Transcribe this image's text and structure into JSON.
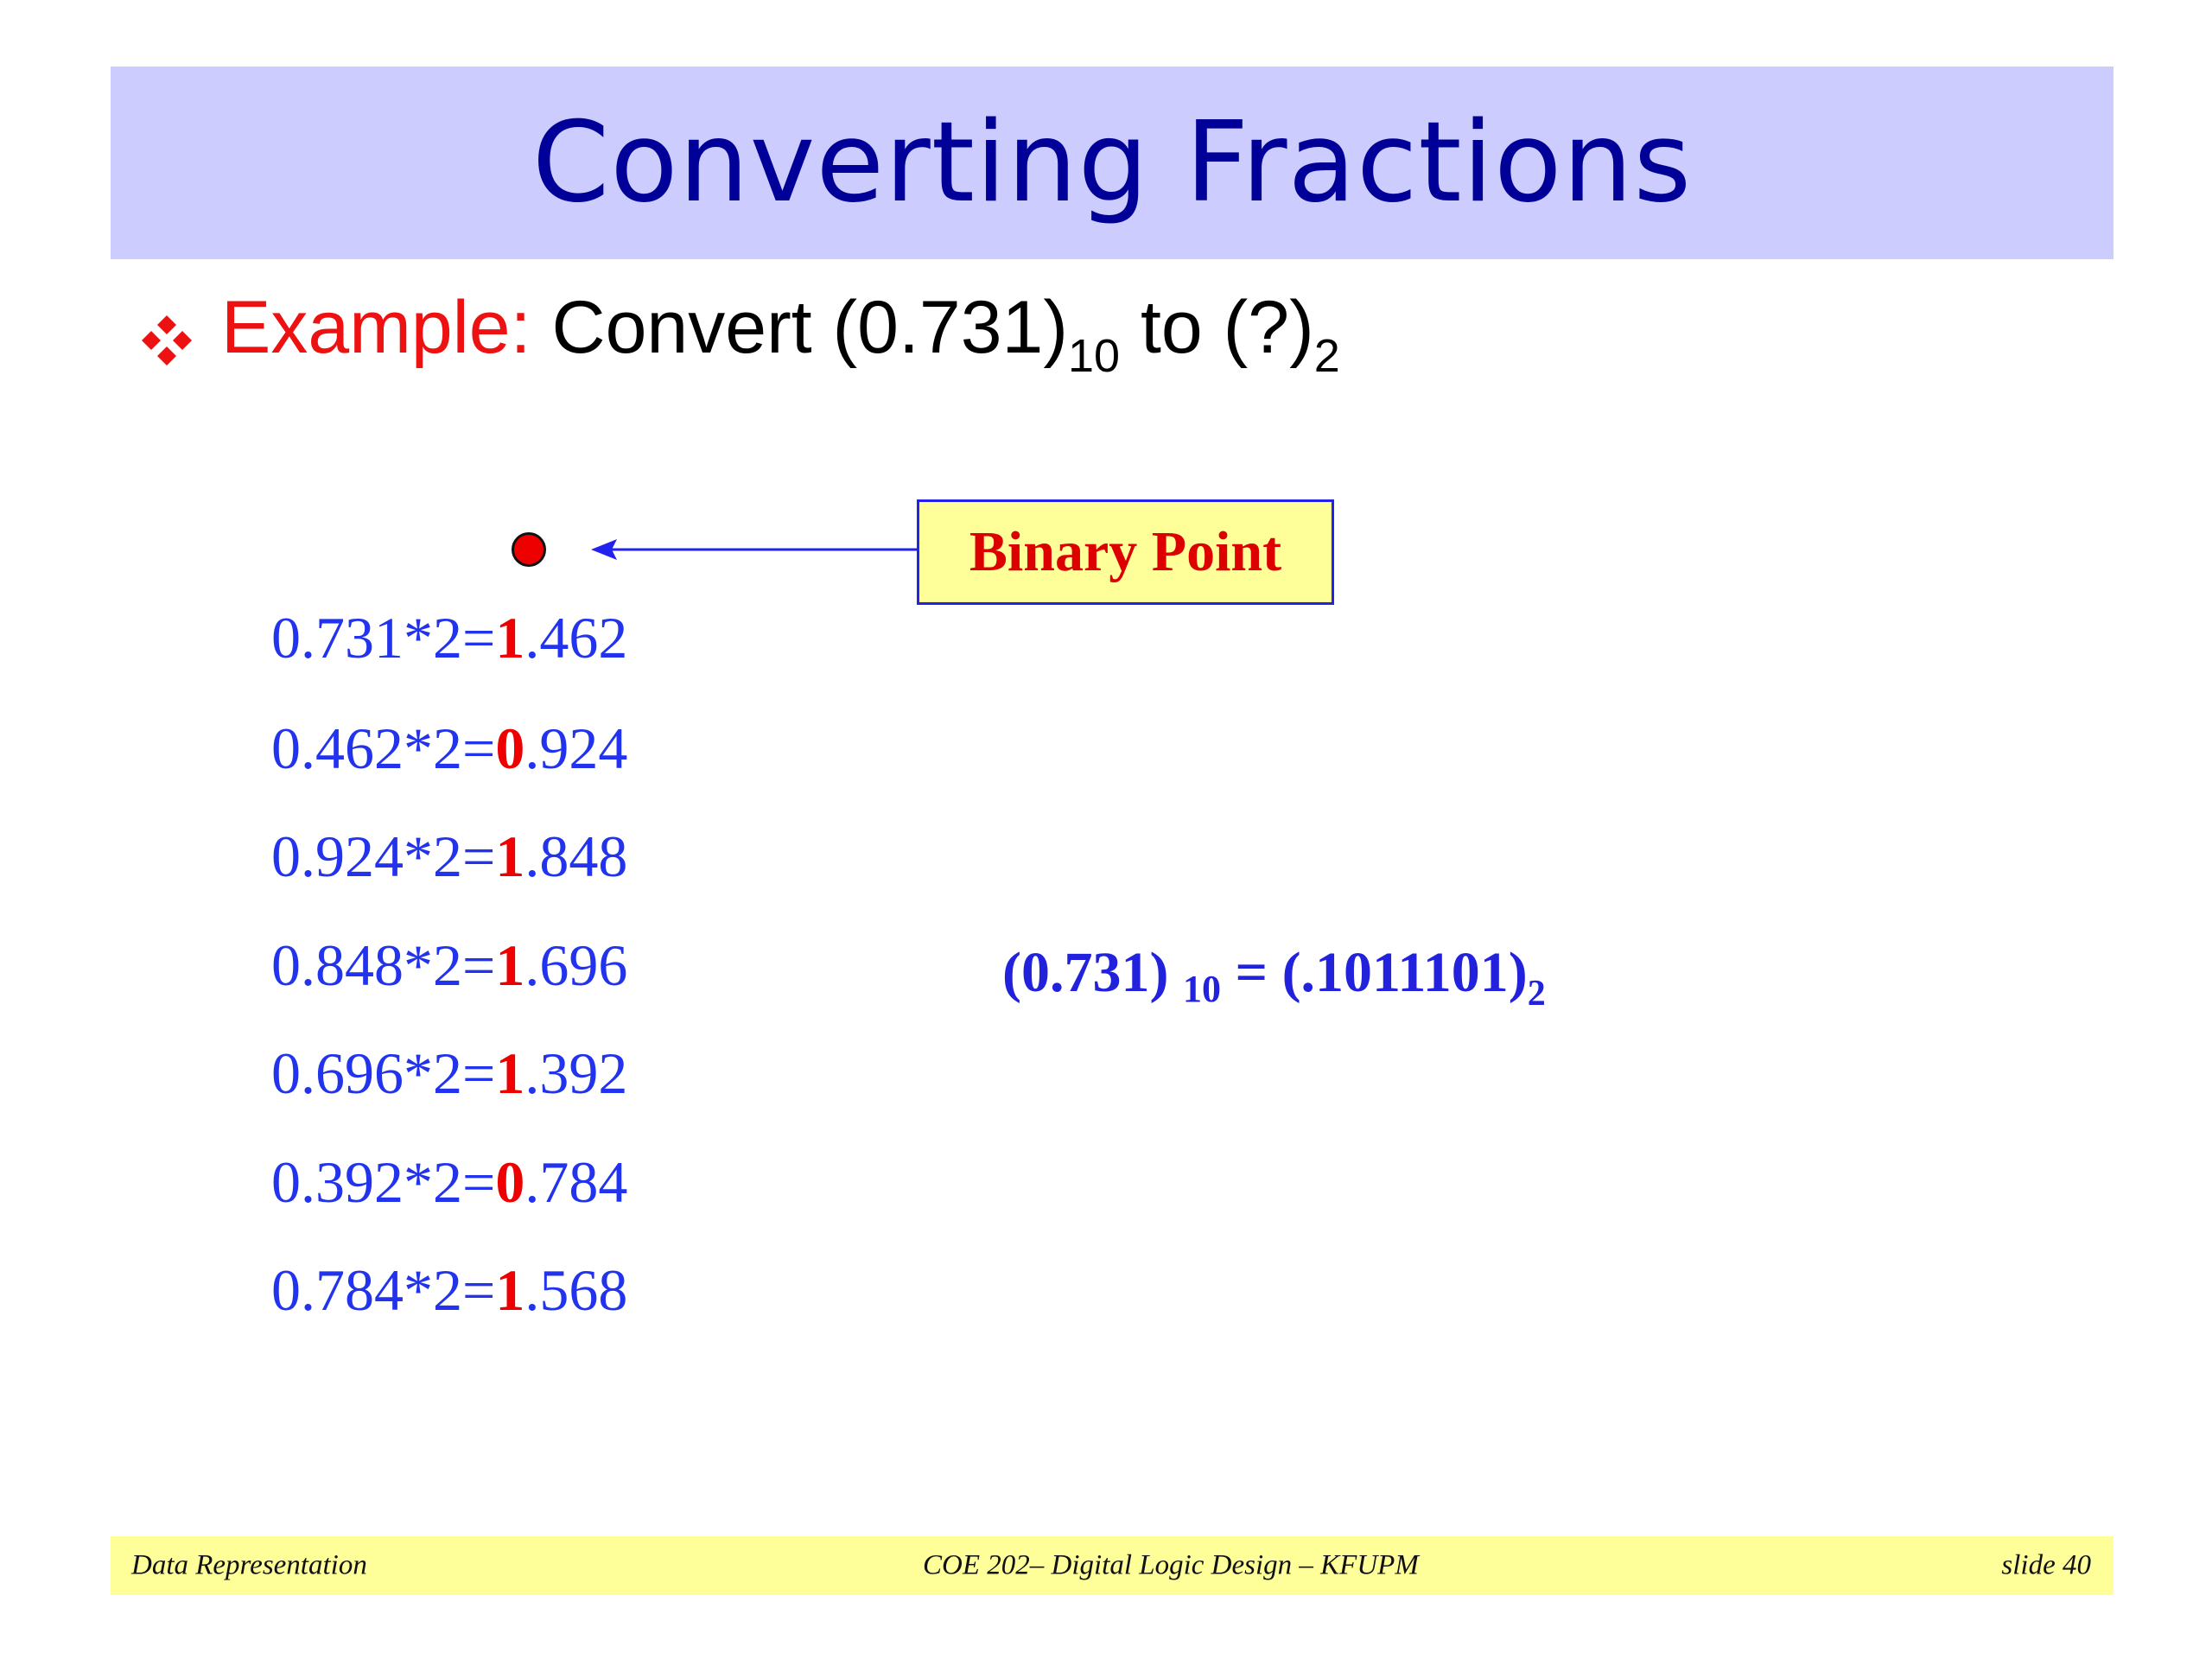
{
  "slide": {
    "title": "Converting Fractions",
    "example": {
      "label": "Example:",
      "text_before": "Convert (0.731)",
      "sub_from": "10",
      "text_middle": " to (?)",
      "sub_to": "2"
    },
    "callout": "Binary Point",
    "steps": [
      {
        "lhs": "0.731*2=",
        "bit": "1",
        "rest": ".462"
      },
      {
        "lhs": "0.462*2=",
        "bit": "0",
        "rest": ".924"
      },
      {
        "lhs": "0.924*2=",
        "bit": "1",
        "rest": ".848"
      },
      {
        "lhs": "0.848*2=",
        "bit": "1",
        "rest": ".696"
      },
      {
        "lhs": "0.696*2=",
        "bit": "1",
        "rest": ".392"
      },
      {
        "lhs": "0.392*2=",
        "bit": "0",
        "rest": ".784"
      },
      {
        "lhs": "0.784*2=",
        "bit": "1",
        "rest": ".568"
      }
    ],
    "result": {
      "left": "(0.731) ",
      "left_sub": "10",
      "middle": " = (.1011101)",
      "right_sub": "2"
    }
  },
  "footer": {
    "left": "Data Representation",
    "center": "COE 202– Digital Logic  Design – KFUPM",
    "right": "slide 40"
  },
  "colors": {
    "title_band": "#ccccff",
    "title_text": "#000099",
    "example_label": "#ee1111",
    "step_text": "#2233ee",
    "bit_highlight": "#ee0000",
    "callout_bg": "#ffff99",
    "footer_bg": "#ffff99"
  },
  "icons": {
    "bullet": "four-diamond-bullet-icon",
    "point": "red-dot-icon",
    "arrow": "arrow-left-icon"
  }
}
